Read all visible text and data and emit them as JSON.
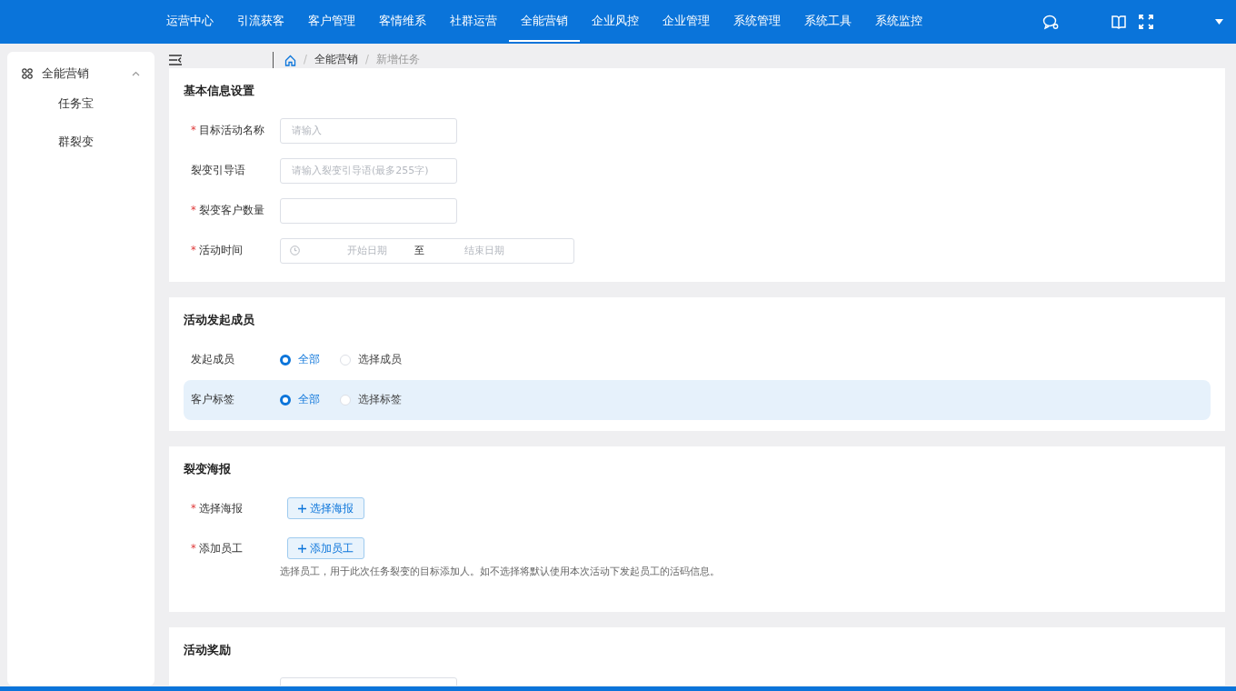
{
  "top_nav": {
    "items": [
      {
        "label": "运营中心",
        "selected": false
      },
      {
        "label": "引流获客",
        "selected": false
      },
      {
        "label": "客户管理",
        "selected": false
      },
      {
        "label": "客情维系",
        "selected": false
      },
      {
        "label": "社群运营",
        "selected": false
      },
      {
        "label": "全能营销",
        "selected": true
      },
      {
        "label": "企业风控",
        "selected": false
      },
      {
        "label": "企业管理",
        "selected": false
      },
      {
        "label": "系统管理",
        "selected": false
      },
      {
        "label": "系统工具",
        "selected": false
      },
      {
        "label": "系统监控",
        "selected": false
      }
    ]
  },
  "sidebar": {
    "group": {
      "label": "全能营销",
      "expanded": true
    },
    "items": [
      {
        "label": "任务宝",
        "selected": false
      },
      {
        "label": "群裂变",
        "selected": false
      }
    ]
  },
  "breadcrumb": [
    {
      "separator": "/",
      "label": "全能营销"
    },
    {
      "separator": "/",
      "label": "新增任务"
    }
  ],
  "sections": [
    {
      "title": "基本信息设置",
      "fields": [
        {
          "kind": "input",
          "label": "目标活动名称",
          "required_mark": "*",
          "placeholder": "请输入"
        },
        {
          "kind": "input",
          "label": "裂变引导语",
          "placeholder": "请输入裂变引导语(最多255字)"
        },
        {
          "kind": "input",
          "label": "裂变客户数量",
          "required_mark": "*"
        },
        {
          "kind": "daterange",
          "label": "活动时间",
          "required_mark": "*",
          "start_placeholder": "开始日期",
          "separator": "至",
          "end_placeholder": "结束日期"
        }
      ]
    },
    {
      "title": "活动发起成员",
      "fields": [
        {
          "kind": "radio",
          "label": "发起成员",
          "highlighted": false,
          "options": [
            {
              "label": "全部",
              "selected": true
            },
            {
              "label": "选择成员",
              "selected": false
            }
          ]
        },
        {
          "kind": "radio",
          "label": "客户标签",
          "highlighted": true,
          "options": [
            {
              "label": "全部",
              "selected": true
            },
            {
              "label": "选择标签",
              "selected": false
            }
          ]
        }
      ]
    },
    {
      "title": "裂变海报",
      "fields": [
        {
          "kind": "button",
          "label": "选择海报",
          "required_mark": "*",
          "button": "选择海报"
        },
        {
          "kind": "button",
          "label": "添加员工",
          "required_mark": "*",
          "button": "添加员工",
          "hint": "选择员工，用于此次任务裂变的目标添加人。如不选择将默认使用本次活动下发起员工的活码信息。"
        }
      ]
    },
    {
      "title": "活动奖励",
      "fields": [
        {
          "kind": "input"
        }
      ]
    }
  ]
}
